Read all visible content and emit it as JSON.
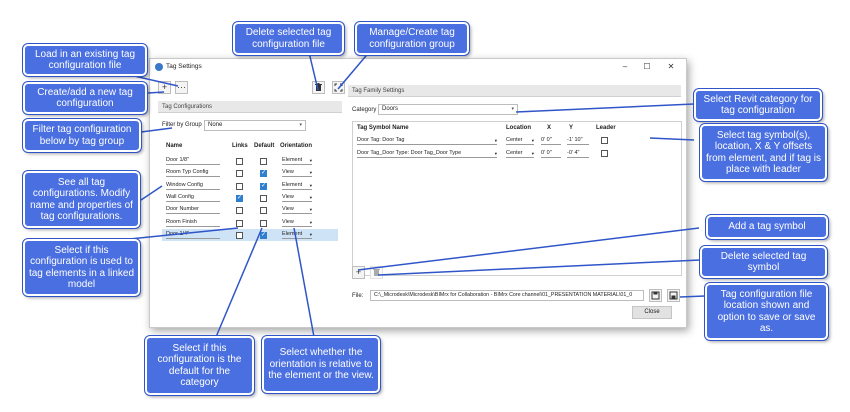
{
  "window": {
    "title": "Tag Settings",
    "min_icon": "–",
    "max_icon": "☐",
    "close_icon": "✕"
  },
  "toolbar": {
    "add_label": "+",
    "load_label": "···",
    "delete_label": "🗑",
    "manage_label": "⛶"
  },
  "left_pane": {
    "header": "Tag Configurations",
    "filter_label": "Filter by Group",
    "filter_value": "None",
    "columns": {
      "name": "Name",
      "links": "Links",
      "default": "Default",
      "orientation": "Orientation"
    },
    "rows": [
      {
        "name": "Door 1/8\"",
        "links": false,
        "default": false,
        "orientation": "Element"
      },
      {
        "name": "Room Typ Config",
        "links": false,
        "default": true,
        "orientation": "View"
      },
      {
        "name": "Window Config",
        "links": false,
        "default": true,
        "orientation": "Element"
      },
      {
        "name": "Wall Config",
        "links": true,
        "default": false,
        "orientation": "View"
      },
      {
        "name": "Door Number",
        "links": false,
        "default": false,
        "orientation": "View"
      },
      {
        "name": "Room Finish",
        "links": false,
        "default": false,
        "orientation": "View"
      },
      {
        "name": "Door 1/4\"",
        "links": false,
        "default": true,
        "orientation": "Element",
        "selected": true
      }
    ]
  },
  "right_pane": {
    "header": "Tag Family Settings",
    "category_label": "Category",
    "category_value": "Doors",
    "columns": {
      "symbol": "Tag Symbol Name",
      "location": "Location",
      "x": "X",
      "y": "Y",
      "leader": "Leader"
    },
    "rows": [
      {
        "symbol": "Door Tag: Door Tag",
        "location": "Center",
        "x": "0' 0\"",
        "y": "-1' 10\"",
        "leader": false
      },
      {
        "symbol": "Door Tag_Door Type: Door Tag_Door Type",
        "location": "Center",
        "x": "0' 0\"",
        "y": "-0' 4\"",
        "leader": false
      }
    ],
    "add_symbol_label": "+",
    "delete_symbol_label": "🗑"
  },
  "file": {
    "label": "File:",
    "path": "C:\\_Microdesk\\Microdesk\\BIMrx for Collaboration - BIMrx Core channel\\01_PRESENTATION MATERIAL\\01_0",
    "save_icon": "save-icon",
    "save_as_icon": "save-as-icon"
  },
  "close_label": "Close",
  "callouts": {
    "load": "Load in an existing tag configuration file",
    "create": "Create/add a new tag configuration",
    "filter": "Filter tag configuration below by tag group",
    "see_all": "See all tag configurations. Modify name and properties of tag configurations.",
    "links": "Select if this configuration is used to tag elements in a linked model",
    "default": "Select if this configuration is the default for the category",
    "orientation": "Select whether the orientation is relative to the element or the view.",
    "delete_file": "Delete selected tag configuration file",
    "manage_group": "Manage/Create tag configuration group",
    "category": "Select Revit category for tag configuration",
    "symbols": "Select tag symbol(s), location, X & Y offsets from element, and if tag is place with leader",
    "add_symbol": "Add a tag symbol",
    "delete_symbol": "Delete selected tag symbol",
    "file_location": "Tag configuration file location shown and option to save or save as."
  },
  "colors": {
    "callout": "#4a6fe0",
    "accent": "#2f7fd0",
    "selected_row": "#cfe3f7"
  }
}
